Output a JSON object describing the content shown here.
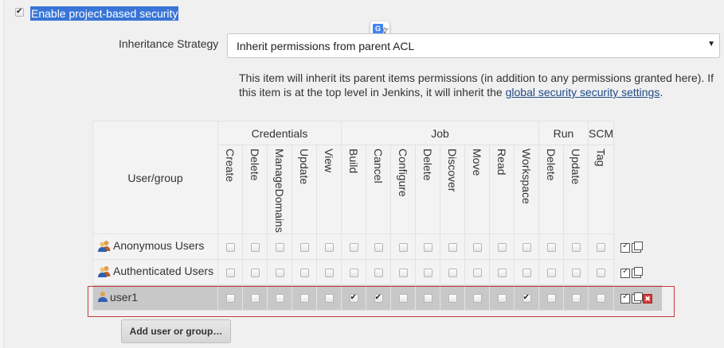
{
  "enable": {
    "label": "Enable project-based security",
    "checked": true
  },
  "inheritance": {
    "label": "Inheritance Strategy",
    "selected": "Inherit permissions from parent ACL",
    "description_prefix": "This item will inherit its parent items permissions (in addition to any permissions granted here). If this item is at the top level in Jenkins, it will inherit the ",
    "description_link": "global security security settings",
    "description_suffix": "."
  },
  "matrix": {
    "user_group_header": "User/group",
    "groups": [
      {
        "label": "Credentials",
        "span": 5
      },
      {
        "label": "Job",
        "span": 8
      },
      {
        "label": "Run",
        "span": 2
      },
      {
        "label": "SCM",
        "span": 1
      }
    ],
    "permissions": [
      "Create",
      "Delete",
      "ManageDomains",
      "Update",
      "View",
      "Build",
      "Cancel",
      "Configure",
      "Delete",
      "Discover",
      "Move",
      "Read",
      "Workspace",
      "Delete",
      "Update",
      "Tag"
    ],
    "rows": [
      {
        "name": "Anonymous Users",
        "icon": "user-group-icon",
        "checks": [
          false,
          false,
          false,
          false,
          false,
          false,
          false,
          false,
          false,
          false,
          false,
          false,
          false,
          false,
          false,
          false
        ],
        "removable": false,
        "selected": false
      },
      {
        "name": "Authenticated Users",
        "icon": "user-group-icon",
        "checks": [
          false,
          false,
          false,
          false,
          false,
          false,
          false,
          false,
          false,
          false,
          false,
          false,
          false,
          false,
          false,
          false
        ],
        "removable": false,
        "selected": false
      },
      {
        "name": "user1",
        "icon": "user-icon",
        "checks": [
          false,
          false,
          false,
          false,
          false,
          true,
          true,
          false,
          false,
          false,
          false,
          false,
          true,
          false,
          false,
          false
        ],
        "removable": true,
        "selected": true
      }
    ]
  },
  "add_button": "Add user or group…",
  "colors": {
    "selection_highlight": "#3875d7",
    "selected_row_outline": "#c9383a",
    "link": "#204a87"
  },
  "icons": {
    "translate": "google-translate-icon",
    "toggle_all": "select-all-icon",
    "copy": "copy-icon",
    "remove": "remove-icon"
  }
}
